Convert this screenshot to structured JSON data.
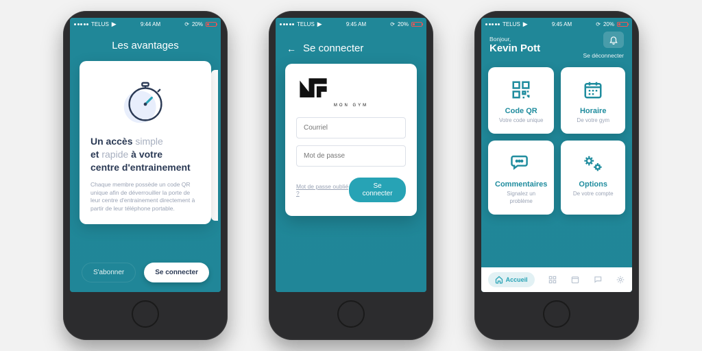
{
  "status": {
    "carrier": "TELUS",
    "battery_pct": "20%",
    "wifi": true
  },
  "screens": [
    {
      "time": "9:44 AM",
      "title": "Les avantages",
      "card": {
        "heading_parts": {
          "p1": "Un accès ",
          "simple": "simple",
          "p2": "et ",
          "rapide": "rapide",
          "p3": " à votre",
          "p4": "centre d'entrainement"
        },
        "desc": "Chaque membre possède un code QR unique afin de déverrouiller la porte de leur centre d'entrainement directement à partir de leur téléphone portable."
      },
      "actions": {
        "subscribe": "S'abonner",
        "signin": "Se connecter"
      }
    },
    {
      "time": "9:45 AM",
      "title": "Se connecter",
      "brand": "MON GYM",
      "email_ph": "Courriel",
      "pass_ph": "Mot de passe",
      "forgot": "Mot de passe oublié ?",
      "submit": "Se connecter"
    },
    {
      "time": "9:45 AM",
      "greeting": "Bonjour,",
      "username": "Kevin Pott",
      "signout": "Se déconnecter",
      "tiles": [
        {
          "title": "Code QR",
          "sub": "Votre code unique"
        },
        {
          "title": "Horaire",
          "sub": "De votre gym"
        },
        {
          "title": "Commentaires",
          "sub": "Signalez un problème"
        },
        {
          "title": "Options",
          "sub": "De votre compte"
        }
      ],
      "tabs": {
        "home": "Accueil"
      }
    }
  ]
}
